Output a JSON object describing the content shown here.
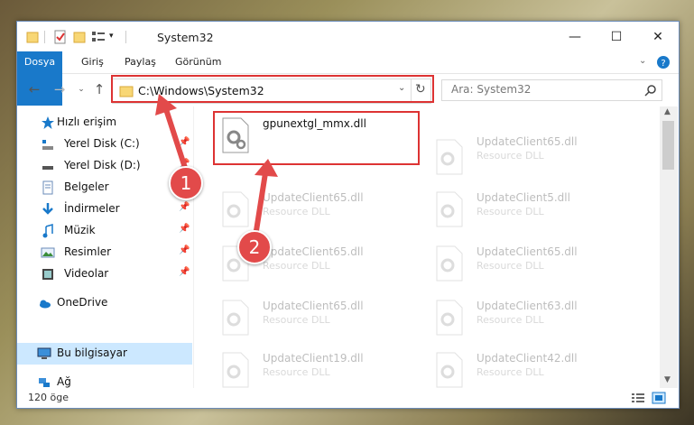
{
  "window": {
    "title": "System32",
    "controls": {
      "minimize": "—",
      "maximize": "☐",
      "close": "✕"
    }
  },
  "ribbon": {
    "tabs": [
      {
        "label": "Dosya",
        "active": true
      },
      {
        "label": "Giriş"
      },
      {
        "label": "Paylaş"
      },
      {
        "label": "Görünüm"
      }
    ],
    "expand_icon": "chevron-down-icon",
    "help_icon": "help-icon"
  },
  "address": {
    "path": "C:\\Windows\\System32",
    "refresh": "↻"
  },
  "search": {
    "placeholder": "Ara: System32"
  },
  "nav": {
    "items": [
      {
        "label": "Hızlı erişim",
        "icon": "star-icon",
        "pinned": false
      },
      {
        "label": "Yerel Disk (C:)",
        "icon": "drive-icon",
        "pinned": true
      },
      {
        "label": "Yerel Disk (D:)",
        "icon": "drive-icon",
        "pinned": true
      },
      {
        "label": "Belgeler",
        "icon": "documents-icon",
        "pinned": true
      },
      {
        "label": "İndirmeler",
        "icon": "download-icon",
        "pinned": true
      },
      {
        "label": "Müzik",
        "icon": "music-icon",
        "pinned": true
      },
      {
        "label": "Resimler",
        "icon": "pictures-icon",
        "pinned": true
      },
      {
        "label": "Videolar",
        "icon": "videos-icon",
        "pinned": true
      },
      {
        "label": "OneDrive",
        "icon": "cloud-icon",
        "pinned": false
      },
      {
        "label": "Bu bilgisayar",
        "icon": "computer-icon",
        "pinned": false,
        "selected": true
      },
      {
        "label": "Ağ",
        "icon": "network-icon",
        "pinned": false
      }
    ]
  },
  "files": {
    "highlighted": {
      "name": "gpunextgl_mmx.dll",
      "type": ""
    },
    "left_column": [
      {
        "name": "UpdateClient65.dll",
        "type": "Resource DLL"
      },
      {
        "name": "UpdateClient65.dll",
        "type": "Resource DLL"
      },
      {
        "name": "UpdateClient65.dll",
        "type": "Resource DLL"
      },
      {
        "name": "UpdateClient19.dll",
        "type": "Resource DLL"
      }
    ],
    "right_column": [
      {
        "name": "UpdateClient65.dll",
        "type": "Resource DLL"
      },
      {
        "name": "UpdateClient5.dll",
        "type": "Resource DLL"
      },
      {
        "name": "UpdateClient65.dll",
        "type": "Resource DLL"
      },
      {
        "name": "UpdateClient63.dll",
        "type": "Resource DLL"
      },
      {
        "name": "UpdateClient42.dll",
        "type": "Resource DLL"
      }
    ]
  },
  "status": {
    "count": "120 öge"
  },
  "annotations": {
    "marker1": "1",
    "marker2": "2",
    "color": "#dd3333"
  }
}
